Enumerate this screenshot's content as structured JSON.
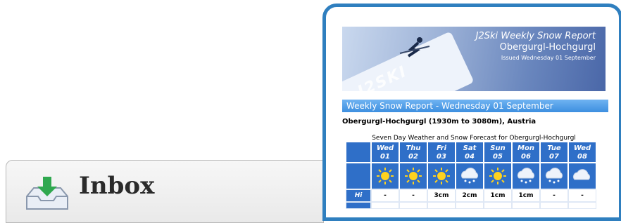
{
  "inbox": {
    "label": "Inbox",
    "icon": "inbox-download-icon"
  },
  "email": {
    "banner": {
      "title": "J2Ski Weekly Snow Report",
      "resort": "Obergurgl-Hochgurgl",
      "issued": "Issued Wednesday 01 September",
      "ski_text": "J2SKI"
    },
    "report_heading": "Weekly Snow Report - Wednesday 01 September",
    "resort_line": "Obergurgl-Hochgurgl (1930m to 3080m), Austria",
    "forecast_title": "Seven Day Weather and Snow Forecast for Obergurgl-Hochgurgl",
    "forecast": {
      "days": [
        {
          "day": "Wed",
          "date": "01",
          "icon": "sun-icon",
          "hi": "-"
        },
        {
          "day": "Thu",
          "date": "02",
          "icon": "sun-icon",
          "hi": "-"
        },
        {
          "day": "Fri",
          "date": "03",
          "icon": "sun-icon",
          "hi": "3cm"
        },
        {
          "day": "Sat",
          "date": "04",
          "icon": "snow-cloud-icon",
          "hi": "2cm"
        },
        {
          "day": "Sun",
          "date": "05",
          "icon": "sun-icon",
          "hi": "1cm"
        },
        {
          "day": "Mon",
          "date": "06",
          "icon": "snow-cloud-icon",
          "hi": "1cm"
        },
        {
          "day": "Tue",
          "date": "07",
          "icon": "snow-cloud-icon",
          "hi": "-"
        },
        {
          "day": "Wed",
          "date": "08",
          "icon": "cloud-icon",
          "hi": "-"
        }
      ],
      "hi_label": "Hi"
    }
  },
  "colors": {
    "frame": "#2f7fbf",
    "grid": "#2f6fc8",
    "bar": "#3d8fe0"
  }
}
